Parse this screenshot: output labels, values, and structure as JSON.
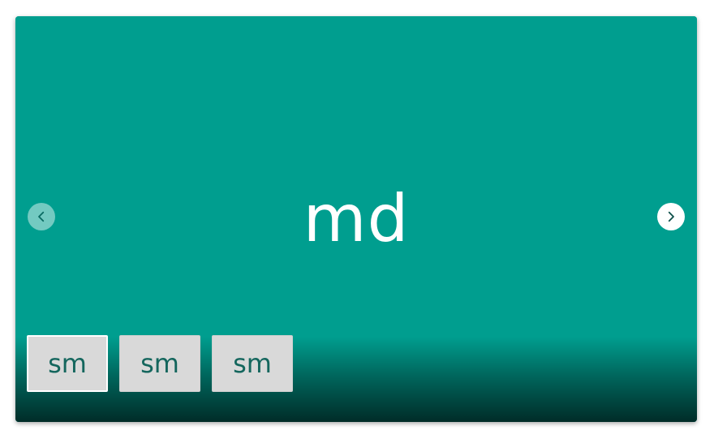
{
  "carousel": {
    "slide": {
      "text": "md"
    },
    "prev_icon": "chevron-left-icon",
    "next_icon": "chevron-right-icon",
    "thumbnails": [
      {
        "label": "sm",
        "active": true
      },
      {
        "label": "sm",
        "active": false
      },
      {
        "label": "sm",
        "active": false
      }
    ]
  },
  "colors": {
    "slide_background": "#009e8f",
    "thumbnail_background": "#d9d9d9",
    "thumbnail_text": "#14665d"
  }
}
